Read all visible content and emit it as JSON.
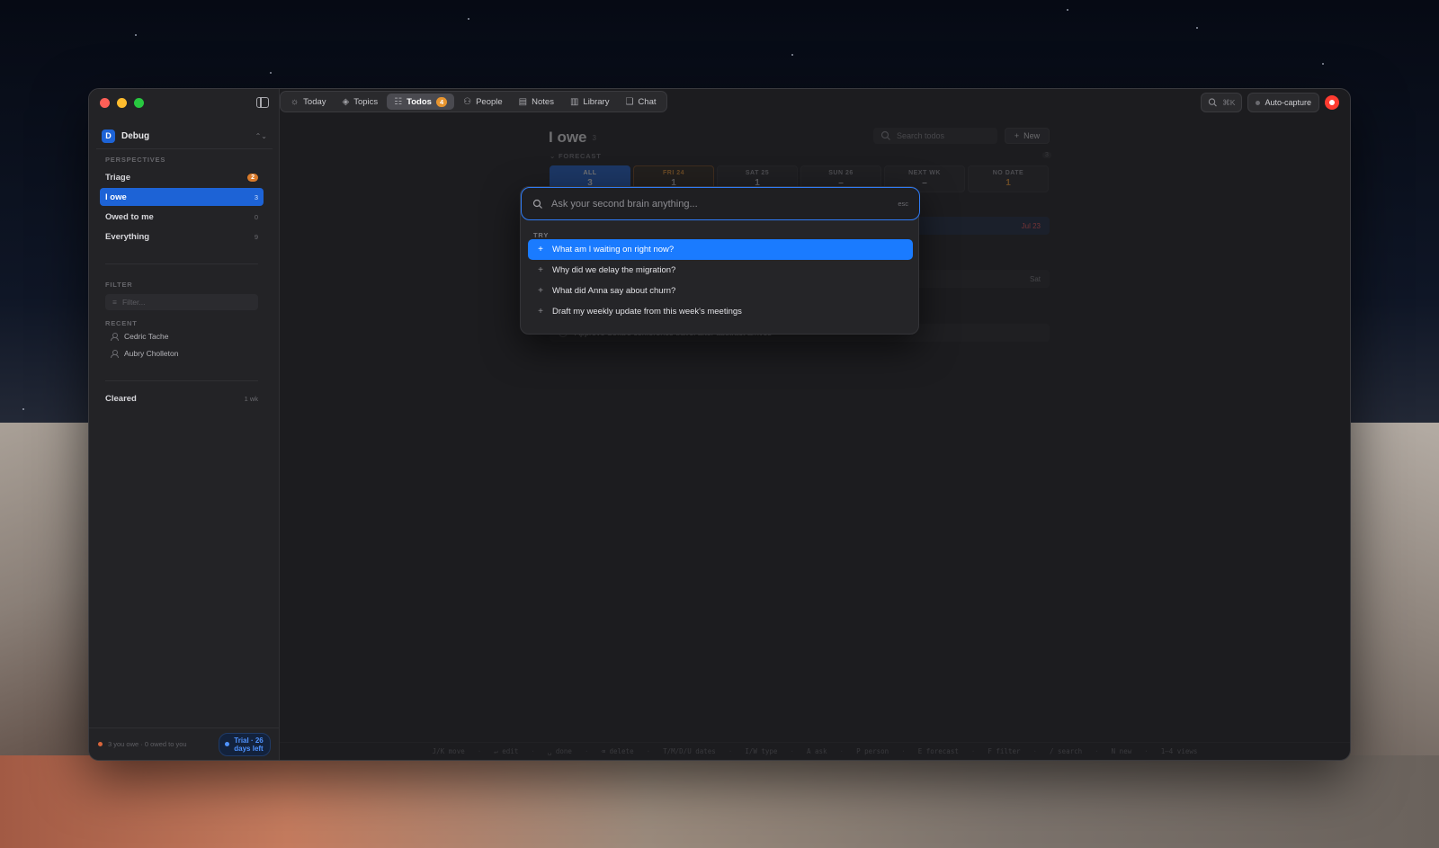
{
  "sidebar": {
    "workspace": {
      "initial": "D",
      "name": "Debug"
    },
    "perspectives_label": "PERSPECTIVES",
    "perspectives": [
      {
        "label": "Triage",
        "count": "2"
      },
      {
        "label": "I owe",
        "count": "3"
      },
      {
        "label": "Owed to me",
        "count": "0"
      },
      {
        "label": "Everything",
        "count": "9"
      }
    ],
    "filter_label": "FILTER",
    "filter_placeholder": "Filter...",
    "recent_label": "RECENT",
    "recent": [
      "Cedric Tache",
      "Aubry Cholleton"
    ],
    "cleared": {
      "label": "Cleared",
      "meta": "1 wk"
    },
    "footer": {
      "summary": "3 you owe · 0 owed to you",
      "trial": "Trial · 26 days left"
    }
  },
  "topnav": {
    "tabs": [
      {
        "label": "Today",
        "icon": "sun-icon"
      },
      {
        "label": "Topics",
        "icon": "layers-icon"
      },
      {
        "label": "Todos",
        "icon": "checklist-icon",
        "badge": "4"
      },
      {
        "label": "People",
        "icon": "people-icon"
      },
      {
        "label": "Notes",
        "icon": "notes-icon"
      },
      {
        "label": "Library",
        "icon": "library-icon"
      },
      {
        "label": "Chat",
        "icon": "chat-icon"
      }
    ],
    "search_shortcut": "⌘K",
    "autocapture": "Auto-capture"
  },
  "main": {
    "title": "I owe",
    "title_count": "3",
    "search_placeholder": "Search todos",
    "new_label": "New",
    "forecast_label": "FORECAST",
    "forecast_count": "3",
    "forecast": [
      {
        "label": "ALL",
        "value": "3"
      },
      {
        "label": "FRI 24",
        "value": "1"
      },
      {
        "label": "SAT 25",
        "value": "1"
      },
      {
        "label": "SUN 26",
        "value": "–"
      },
      {
        "label": "NEXT WK",
        "value": "–"
      },
      {
        "label": "NO DATE",
        "value": "1"
      }
    ],
    "rows": [
      {
        "text": "",
        "date": "Jul 23"
      },
      {
        "text": "",
        "date": "Sat"
      },
      {
        "text": "Approve Sofia's conference travel after abstract arrives",
        "date": ""
      }
    ]
  },
  "palette": {
    "placeholder": "Ask your second brain anything...",
    "esc": "esc",
    "try_label": "TRY",
    "suggestions": [
      "What am I waiting on right now?",
      "Why did we delay the migration?",
      "What did Anna say about churn?",
      "Draft my weekly update from this week's meetings"
    ]
  },
  "statusbar": [
    "J/K move",
    "↵ edit",
    "␣ done",
    "⌫ delete",
    "T/M/D/U dates",
    "I/W type",
    "A ask",
    "P person",
    "E forecast",
    "F filter",
    "/ search",
    "N new",
    "1–4 views"
  ],
  "colors": {
    "accent": "#1d63d6",
    "highlight": "#1a7bff",
    "orange": "#e8952f",
    "record": "#ff3b30"
  }
}
